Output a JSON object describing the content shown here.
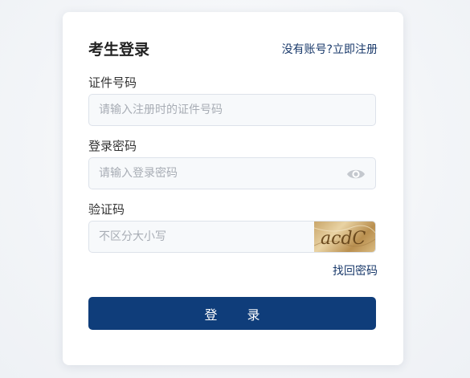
{
  "login": {
    "title": "考生登录",
    "register_link": "没有账号?立即注册",
    "id_label": "证件号码",
    "id_placeholder": "请输入注册时的证件号码",
    "password_label": "登录密码",
    "password_placeholder": "请输入登录密码",
    "captcha_label": "验证码",
    "captcha_placeholder": "不区分大小写",
    "captcha_text": "acdC",
    "forgot_link": "找回密码",
    "submit_label": "登 录"
  },
  "icons": {
    "password_toggle": "eye-icon"
  },
  "colors": {
    "brand": "#0f3d7a",
    "link": "#1a3a6b"
  }
}
